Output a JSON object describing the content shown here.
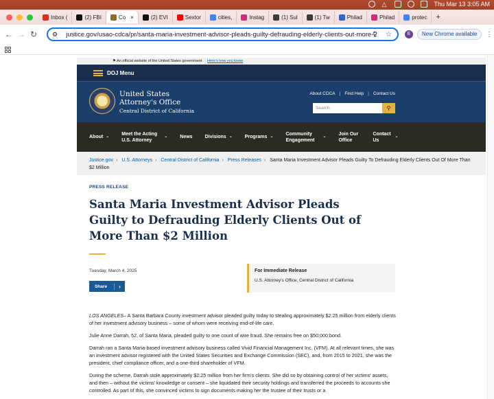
{
  "system": {
    "clock": "Thu Mar 13  3:05 AM"
  },
  "tabs": [
    {
      "label": "Inbox (",
      "color": "#d93025"
    },
    {
      "label": "(2) FBI",
      "color": "#111111"
    },
    {
      "label": "Co",
      "color": "#8a6d2b",
      "active": true
    },
    {
      "label": "(2) EVI",
      "color": "#111111"
    },
    {
      "label": "Sextor",
      "color": "#ff0000"
    },
    {
      "label": "cities,",
      "color": "#4285f4"
    },
    {
      "label": "Instag",
      "color": "#d62976"
    },
    {
      "label": "(1) Sul",
      "color": "#3b3b3b"
    },
    {
      "label": "(1) Tw",
      "color": "#3b3b3b"
    },
    {
      "label": "Philad",
      "color": "#3366cc"
    },
    {
      "label": "Philad",
      "color": "#d62976"
    },
    {
      "label": "protec",
      "color": "#4285f4"
    }
  ],
  "toolbar": {
    "url": "justice.gov/usao-cdca/pr/santa-maria-investment-advisor-pleads-guilty-defrauding-elderly-clients-out-more-2",
    "profile_initial": "E",
    "new_chrome": "New Chrome available"
  },
  "gov_banner": {
    "text": "An official website of the United States government",
    "link": "Here's how you know"
  },
  "doj_menu": "DOJ Menu",
  "header": {
    "line1": "United States",
    "line2": "Attorney's Office",
    "line3": "Central District of California",
    "links": [
      "About CDCA",
      "Find Help",
      "Contact Us"
    ],
    "search_placeholder": "Search"
  },
  "nav": [
    {
      "label": "About",
      "dropdown": true
    },
    {
      "label": "Meet the Acting U.S. Attorney",
      "dropdown": true
    },
    {
      "label": "News",
      "dropdown": false
    },
    {
      "label": "Divisions",
      "dropdown": true
    },
    {
      "label": "Programs",
      "dropdown": true
    },
    {
      "label": "Community Engagement",
      "dropdown": true
    },
    {
      "label": "Join Our Office",
      "dropdown": false
    },
    {
      "label": "Contact Us",
      "dropdown": true
    }
  ],
  "breadcrumbs": [
    "Justice.gov",
    "U.S. Attorneys",
    "Central District of California",
    "Press Releases",
    "Santa Maria Investment Advisor Pleads Guilty To Defrauding Elderly Clients Out Of More Than $2 Million"
  ],
  "article": {
    "kicker": "PRESS RELEASE",
    "title": "Santa Maria Investment Advisor Pleads Guilty to Defrauding Elderly Clients Out of More Than $2 Million",
    "date": "Tuesday, March 4, 2025",
    "share": "Share",
    "release_heading": "For Immediate Release",
    "release_source": "U.S. Attorney's Office, Central District of California",
    "dateline": "LOS ANGELES",
    "p1": "– A Santa Barbara County investment advisor pleaded guilty today to stealing approximately $2.25 million from elderly clients of her investment advisory business – some of whom were receiving end-of-life care.",
    "p2": "Julie Anne Darrah, 52, of Santa Maria, pleaded guilty to one count of wire fraud. She remains free on $50,000 bond.",
    "p3": "Darrah ran a Santa Maria-based investment advisory business called Vivid Financial Management Inc. (VFM). At all relevant times, she was an investment advisor registered with the United States Securities and Exchange Commission (SEC), and, from 2015 to 2021, she was the president, chief compliance officer, and a one-third shareholder of VFM.",
    "p4": "During the scheme, Darrah stole approximately $2.25 million from her firm's clients. She did so by obtaining control of her victims' assets, and then – without the victims' knowledge or consent – she liquidated their security holdings and transferred the proceeds to accounts she controlled. As part of this, she convinced victims to sign documents making her the trustee of their trusts or a"
  }
}
